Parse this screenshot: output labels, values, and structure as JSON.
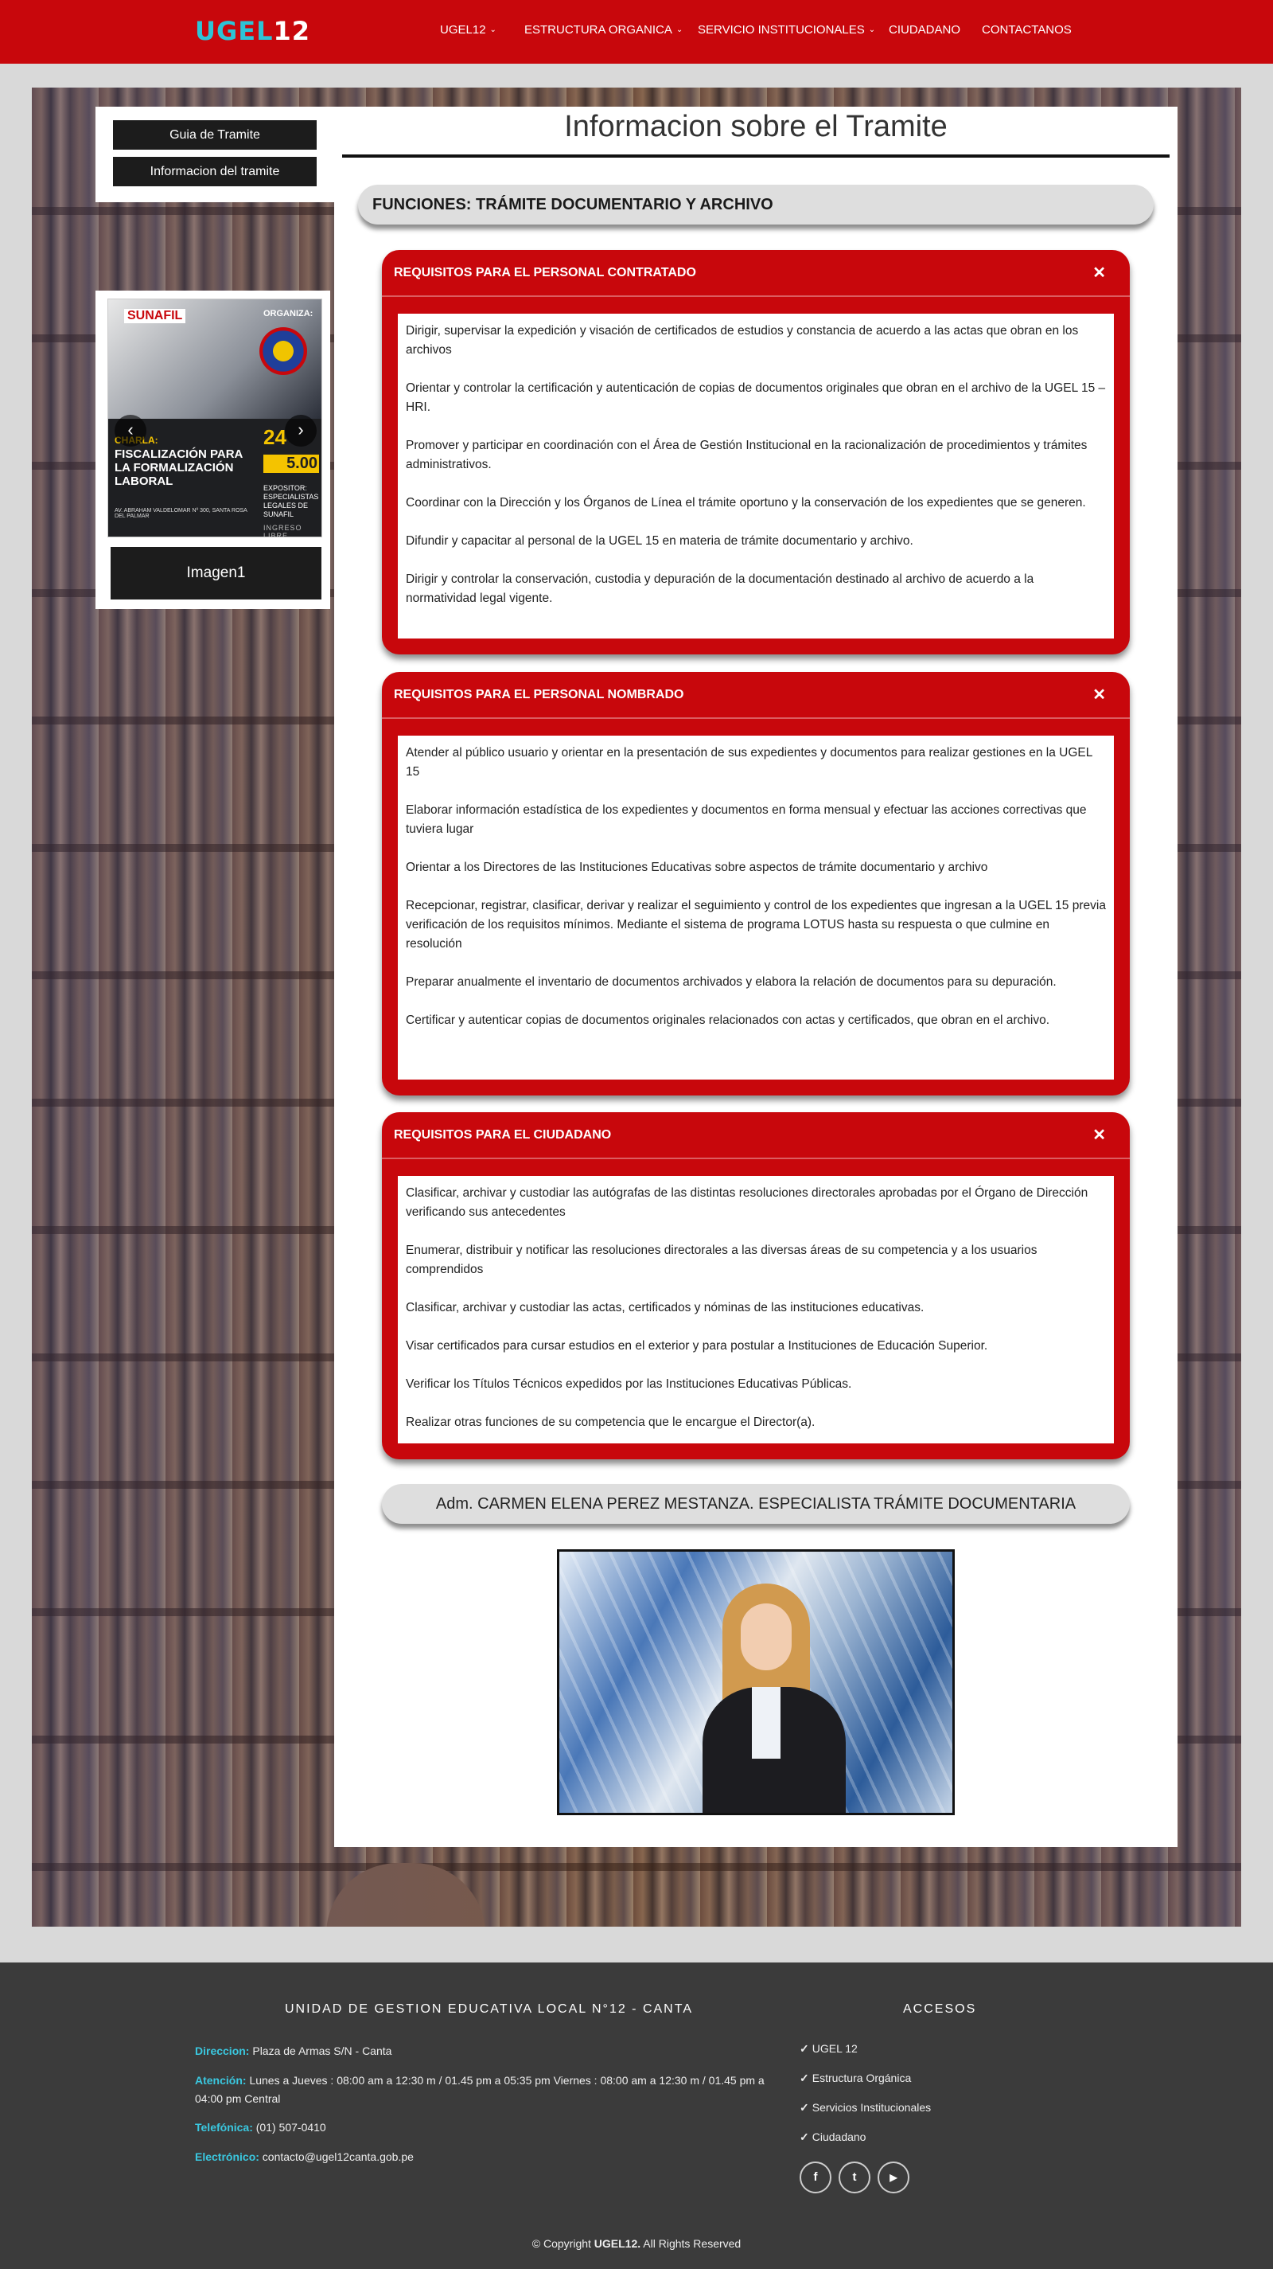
{
  "brand": {
    "logo_part1": "UGEL",
    "logo_part2": "12"
  },
  "nav": {
    "items": [
      {
        "label": "UGEL12",
        "has_dropdown": true
      },
      {
        "label": "ESTRUCTURA ORGANICA",
        "has_dropdown": true
      },
      {
        "label": "SERVICIO INSTITUCIONALES",
        "has_dropdown": true
      },
      {
        "label": "CIUDADANO",
        "has_dropdown": false
      },
      {
        "label": "CONTACTANOS",
        "has_dropdown": false
      }
    ],
    "caret": "⌄"
  },
  "sidebar": {
    "buttons": [
      "Guia de Tramite",
      "Informacion del tramite"
    ],
    "slider": {
      "poster": {
        "org": "SUNAFIL",
        "organiza": "ORGANIZA:",
        "charla": "CHARLA:",
        "title": "FISCALIZACIÓN PARA LA FORMALIZACIÓN LABORAL",
        "day": "24",
        "time": "5.00",
        "expositor": "EXPOSITOR: ESPECIALISTAS LEGALES DE SUNAFIL",
        "ingreso": "INGRESO LIBRE",
        "address": "AV. ABRAHAM VALDELOMAR Nº 300, SANTA ROSA DEL PALMAR"
      },
      "prev_icon": "‹",
      "next_icon": "›",
      "caption": "Imagen1"
    }
  },
  "main": {
    "title": "Informacion sobre el Tramite",
    "section_title": "FUNCIONES: TRÁMITE DOCUMENTARIO Y ARCHIVO",
    "panels": [
      {
        "title": "REQUISITOS PARA EL PERSONAL CONTRATADO",
        "close": "✕",
        "items": [
          "Dirigir, supervisar la expedición y visación de certificados de estudios y constancia de acuerdo a las actas que obran en los archivos",
          "Orientar y controlar la certificación y autenticación de copias de documentos originales que obran en el archivo de la UGEL 15 – HRI.",
          "Promover y participar en coordinación con el Área de Gestión Institucional en la racionalización de procedimientos y trámites administrativos.",
          "Coordinar con la Dirección y los Órganos de Línea el trámite oportuno y la conservación de los expedientes que se generen.",
          "Difundir y capacitar al personal de la UGEL 15 en materia de trámite documentario y archivo.",
          "Dirigir y controlar la conservación, custodia y depuración de la documentación destinado al archivo de acuerdo a la normatividad legal vigente."
        ]
      },
      {
        "title": "REQUISITOS PARA EL PERSONAL NOMBRADO",
        "close": "✕",
        "items": [
          "Atender al público usuario y orientar en la presentación de sus expedientes y documentos para realizar gestiones en la UGEL 15",
          "Elaborar información estadística de los expedientes y documentos en forma mensual y efectuar las acciones correctivas que tuviera lugar",
          "Orientar a los Directores de las Instituciones Educativas sobre aspectos de trámite documentario y archivo",
          "Recepcionar, registrar, clasificar, derivar y realizar el seguimiento y control de los expedientes que ingresan a la UGEL 15 previa verificación de los requisitos mínimos. Mediante el sistema de programa LOTUS hasta su respuesta o que culmine en resolución",
          "Preparar anualmente el inventario de documentos archivados y elabora la relación de documentos para su depuración.",
          "Certificar y autenticar copias de documentos originales relacionados con actas y certificados, que obran en el archivo."
        ]
      },
      {
        "title": "REQUISITOS PARA EL CIUDADANO",
        "close": "✕",
        "items": [
          "Clasificar, archivar y custodiar las autógrafas de las distintas resoluciones directorales aprobadas por el Órgano de Dirección verificando sus antecedentes",
          "Enumerar, distribuir y notificar las resoluciones directorales a las diversas áreas de su competencia y a los usuarios comprendidos",
          "Clasificar, archivar y custodiar las actas, certificados y nóminas de las instituciones educativas.",
          "Visar certificados para cursar estudios en el exterior y para postular a Instituciones de Educación Superior.",
          "Verificar los Títulos Técnicos expedidos por las Instituciones Educativas Públicas.",
          "Realizar otras funciones de su competencia que le encargue el Director(a)."
        ]
      }
    ],
    "responsible": "Adm. CARMEN ELENA PEREZ MESTANZA. ESPECIALISTA TRÁMITE DOCUMENTARIA"
  },
  "footer": {
    "org_title": "UNIDAD DE GESTION EDUCATIVA LOCAL N°12 - CANTA",
    "contact": [
      {
        "key": "Direccion:",
        "value": " Plaza de Armas S/N - Canta"
      },
      {
        "key": "Atención:",
        "value": " Lunes a Jueves : 08:00 am a 12:30 m / 01.45 pm a 05:35 pm Viernes : 08:00 am a 12:30 m / 01.45 pm a 04:00 pm Central"
      },
      {
        "key": "Telefónica:",
        "value": " (01) 507-0410"
      },
      {
        "key": "Electrónico:",
        "value": " contacto@ugel12canta.gob.pe"
      }
    ],
    "access_title": "ACCESOS",
    "access_links": [
      "UGEL 12",
      "Estructura Orgánica",
      "Servicios Institucionales",
      "Ciudadano"
    ],
    "check_icon": "✓",
    "social": [
      {
        "name": "facebook-icon",
        "glyph": "f"
      },
      {
        "name": "twitter-icon",
        "glyph": "t"
      },
      {
        "name": "youtube-icon",
        "glyph": "▶"
      }
    ],
    "copyright_prefix": "© Copyright ",
    "copyright_brand": "UGEL12.",
    "copyright_suffix": " All Rights Reserved"
  },
  "colors": {
    "primary_red": "#c8070c",
    "logo_cyan": "#2ec4d6",
    "footer_bg": "#3b3b3b",
    "footer_key": "#3ac8e0"
  }
}
